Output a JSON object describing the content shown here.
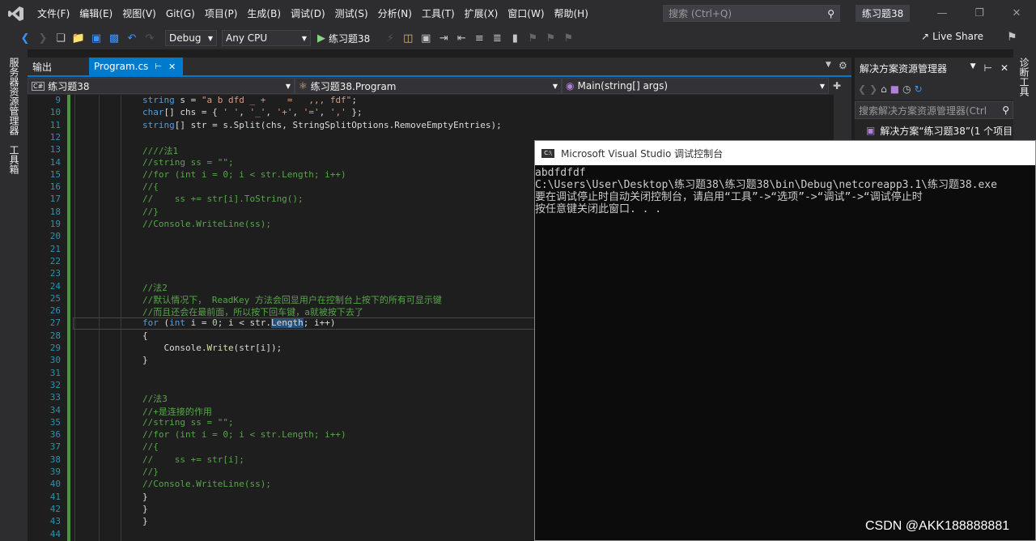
{
  "menu": {
    "items": [
      "文件(F)",
      "编辑(E)",
      "视图(V)",
      "Git(G)",
      "项目(P)",
      "生成(B)",
      "调试(D)",
      "测试(S)",
      "分析(N)",
      "工具(T)",
      "扩展(X)",
      "窗口(W)",
      "帮助(H)"
    ],
    "search_placeholder": "搜索 (Ctrl+Q)",
    "solution_name": "练习题38"
  },
  "toolbar": {
    "config": "Debug",
    "platform": "Any CPU",
    "run_label": "练习题38",
    "live_share": "Live Share"
  },
  "left_panels": [
    "服务器资源管理器",
    "工具箱"
  ],
  "right_panels": [
    "诊断工具"
  ],
  "tabs": [
    {
      "label": "输出"
    },
    {
      "label": "Program.cs"
    }
  ],
  "nav": {
    "project": "练习题38",
    "class": "练习题38.Program",
    "member": "Main(string[] args)"
  },
  "code_lines": [
    {
      "n": "9",
      "html": "<span class='kw'>string</span> s = <span class='str'>\"a b dfd _ +    =   ,,, fdf\"</span>;"
    },
    {
      "n": "10",
      "html": "<span class='kw'>char</span>[] chs = { <span class='str'>' '</span>, <span class='str'>'_'</span>, <span class='str'>'+'</span>, <span class='str'>'='</span>, <span class='str'>','</span> };"
    },
    {
      "n": "11",
      "html": "<span class='kw'>string</span>[] str = s.Split(chs, StringSplitOptions.RemoveEmptyEntries);"
    },
    {
      "n": "12",
      "html": ""
    },
    {
      "n": "13",
      "html": "<span class='cm'>////法1</span>"
    },
    {
      "n": "14",
      "html": "<span class='cm'>//string ss = \"\";</span>"
    },
    {
      "n": "15",
      "html": "<span class='cm'>//for (int i = 0; i &lt; str.Length; i++)</span>"
    },
    {
      "n": "16",
      "html": "<span class='cm'>//{</span>"
    },
    {
      "n": "17",
      "html": "<span class='cm'>//    ss += str[i].ToString();</span>"
    },
    {
      "n": "18",
      "html": "<span class='cm'>//}</span>"
    },
    {
      "n": "19",
      "html": "<span class='cm'>//Console.WriteLine(ss);</span>"
    },
    {
      "n": "20",
      "html": ""
    },
    {
      "n": "21",
      "html": ""
    },
    {
      "n": "22",
      "html": ""
    },
    {
      "n": "23",
      "html": ""
    },
    {
      "n": "24",
      "html": "<span class='cm'>//法2</span>"
    },
    {
      "n": "25",
      "html": "<span class='cm'>//默认情况下， ReadKey 方法会回显用户在控制台上按下的所有可显示键</span>"
    },
    {
      "n": "26",
      "html": "<span class='cm'>//而且还会在最前面，所以按下回车键，a就被按下去了</span>"
    },
    {
      "n": "27",
      "html": "<span class='kw'>for</span> (<span class='kw'>int</span> i = <span class='num'>0</span>; i &lt; str.<span class='hl'>Length</span>; i++)"
    },
    {
      "n": "28",
      "html": "{"
    },
    {
      "n": "29",
      "html": "    Console.<span class='fn'>Write</span>(str[i]);"
    },
    {
      "n": "30",
      "html": "}"
    },
    {
      "n": "31",
      "html": ""
    },
    {
      "n": "32",
      "html": ""
    },
    {
      "n": "33",
      "html": "<span class='cm'>//法3</span>"
    },
    {
      "n": "34",
      "html": "<span class='cm'>//+是连接的作用</span>"
    },
    {
      "n": "35",
      "html": "<span class='cm'>//string ss = \"\";</span>"
    },
    {
      "n": "36",
      "html": "<span class='cm'>//for (int i = 0; i &lt; str.Length; i++)</span>"
    },
    {
      "n": "37",
      "html": "<span class='cm'>//{</span>"
    },
    {
      "n": "38",
      "html": "<span class='cm'>//    ss += str[i];</span>"
    },
    {
      "n": "39",
      "html": "<span class='cm'>//}</span>"
    },
    {
      "n": "40",
      "html": "<span class='cm'>//Console.WriteLine(ss);</span>"
    },
    {
      "n": "41",
      "html": "}"
    },
    {
      "n": "42",
      "html": "}"
    },
    {
      "n": "43",
      "html": "}"
    },
    {
      "n": "44",
      "html": ""
    }
  ],
  "solution_explorer": {
    "title": "解决方案资源管理器",
    "search_placeholder": "搜索解决方案资源管理器(Ctrl",
    "root": "解决方案“练习题38”(1 个项目"
  },
  "console": {
    "title": "Microsoft Visual Studio 调试控制台",
    "lines": [
      "abdfdfdf",
      "C:\\Users\\User\\Desktop\\练习题38\\练习题38\\bin\\Debug\\netcoreapp3.1\\练习题38.exe",
      "要在调试停止时自动关闭控制台，请启用“工具”->“选项”->“调试”->“调试停止时",
      "按任意键关闭此窗口. . ."
    ]
  },
  "watermark": "CSDN @AKK188888881",
  "colors": {
    "accent": "#007acc",
    "keyword": "#569cd6",
    "comment": "#57a64a",
    "string": "#d69d85",
    "linenum": "#2b91af"
  }
}
